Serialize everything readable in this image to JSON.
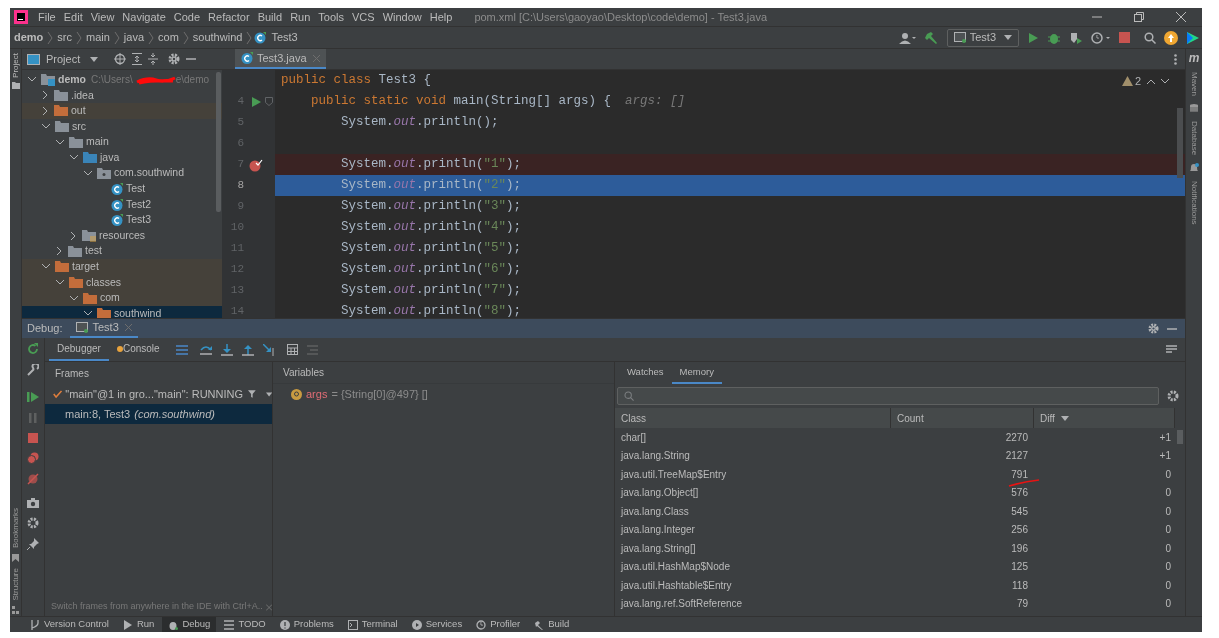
{
  "window": {
    "title": "pom.xml [C:\\Users\\gaoyao\\Desktop\\code\\demo] - Test3.java"
  },
  "menu": [
    "File",
    "Edit",
    "View",
    "Navigate",
    "Code",
    "Refactor",
    "Build",
    "Run",
    "Tools",
    "VCS",
    "Window",
    "Help"
  ],
  "breadcrumb": [
    "demo",
    "src",
    "main",
    "java",
    "com",
    "southwind",
    "Test3"
  ],
  "run_config": "Test3",
  "left_stripe": {
    "top": [
      "Project"
    ],
    "bottom": [
      "Bookmarks",
      "Structure"
    ]
  },
  "right_stripe": {
    "maven_icon": "m",
    "items": [
      "Maven",
      "Database",
      "Notifications"
    ]
  },
  "project_panel": {
    "title": "Project",
    "tree": [
      {
        "name": "demo",
        "path_start": "C:\\Users\\",
        "path_end": "e\\demo",
        "kind": "module",
        "expanded": true,
        "excluded": false,
        "selected": false,
        "children": [
          {
            "name": ".idea",
            "kind": "folder",
            "expanded": false,
            "excluded": false,
            "selected": false
          },
          {
            "name": "out",
            "kind": "folder",
            "expanded": false,
            "excluded": true,
            "selected": false
          },
          {
            "name": "src",
            "kind": "folder",
            "expanded": true,
            "excluded": false,
            "selected": false,
            "children": [
              {
                "name": "main",
                "kind": "folder",
                "expanded": true,
                "excluded": false,
                "selected": false,
                "children": [
                  {
                    "name": "java",
                    "kind": "source",
                    "expanded": true,
                    "excluded": false,
                    "selected": false,
                    "children": [
                      {
                        "name": "com.southwind",
                        "kind": "package",
                        "expanded": true,
                        "excluded": false,
                        "selected": false,
                        "children": [
                          {
                            "name": "Test",
                            "kind": "class",
                            "selected": false
                          },
                          {
                            "name": "Test2",
                            "kind": "class",
                            "selected": false
                          },
                          {
                            "name": "Test3",
                            "kind": "class",
                            "selected": false
                          }
                        ]
                      }
                    ]
                  },
                  {
                    "name": "resources",
                    "kind": "resources",
                    "expanded": false,
                    "excluded": false,
                    "selected": false
                  }
                ]
              },
              {
                "name": "test",
                "kind": "folder",
                "expanded": false,
                "excluded": false,
                "selected": false
              }
            ]
          },
          {
            "name": "target",
            "kind": "folder",
            "expanded": true,
            "excluded": true,
            "selected": false,
            "children": [
              {
                "name": "classes",
                "kind": "folder",
                "expanded": true,
                "excluded": true,
                "selected": false,
                "children": [
                  {
                    "name": "com",
                    "kind": "folder",
                    "expanded": true,
                    "excluded": true,
                    "selected": false,
                    "children": [
                      {
                        "name": "southwind",
                        "kind": "folder",
                        "expanded": true,
                        "excluded": true,
                        "selected": true
                      }
                    ]
                  }
                ]
              }
            ]
          }
        ]
      }
    ]
  },
  "editor": {
    "tab": "Test3.java",
    "warnings": "2",
    "lines": [
      {
        "tokens": [
          {
            "text": "public class ",
            "kind": "keyword"
          },
          {
            "text": "Test3 {",
            "kind": "plain"
          }
        ],
        "run": false,
        "breakpoint": false,
        "current": false
      },
      {
        "number": "4",
        "tokens": [
          {
            "text": "    public static void ",
            "kind": "keyword"
          },
          {
            "text": "main(String[] args) {",
            "kind": "plain"
          },
          {
            "text": "args: []",
            "kind": "hint"
          }
        ],
        "run": true,
        "breakpoint": false,
        "current": false
      },
      {
        "number": "5",
        "tokens": [
          {
            "text": "        System.",
            "kind": "plain"
          },
          {
            "text": "out",
            "kind": "field"
          },
          {
            "text": ".println();",
            "kind": "plain"
          }
        ],
        "run": false,
        "breakpoint": false,
        "current": false
      },
      {
        "number": "6",
        "run": false,
        "breakpoint": false,
        "current": false
      },
      {
        "number": "7",
        "tokens": [
          {
            "text": "        System.",
            "kind": "plain"
          },
          {
            "text": "out",
            "kind": "field"
          },
          {
            "text": ".println(",
            "kind": "plain"
          },
          {
            "text": "\"1\"",
            "kind": "string"
          },
          {
            "text": ");",
            "kind": "plain"
          }
        ],
        "run": false,
        "breakpoint": true,
        "current": false
      },
      {
        "number": "8",
        "tokens": [
          {
            "text": "        System.",
            "kind": "plain"
          },
          {
            "text": "out",
            "kind": "field"
          },
          {
            "text": ".println(",
            "kind": "plain"
          },
          {
            "text": "\"2\"",
            "kind": "string"
          },
          {
            "text": ");",
            "kind": "plain"
          }
        ],
        "run": false,
        "breakpoint": false,
        "current": true
      },
      {
        "number": "9",
        "tokens": [
          {
            "text": "        System.",
            "kind": "plain"
          },
          {
            "text": "out",
            "kind": "field"
          },
          {
            "text": ".println(",
            "kind": "plain"
          },
          {
            "text": "\"3\"",
            "kind": "string"
          },
          {
            "text": ");",
            "kind": "plain"
          }
        ],
        "run": false,
        "breakpoint": false,
        "current": false
      },
      {
        "number": "10",
        "tokens": [
          {
            "text": "        System.",
            "kind": "plain"
          },
          {
            "text": "out",
            "kind": "field"
          },
          {
            "text": ".println(",
            "kind": "plain"
          },
          {
            "text": "\"4\"",
            "kind": "string"
          },
          {
            "text": ");",
            "kind": "plain"
          }
        ],
        "run": false,
        "breakpoint": false,
        "current": false
      },
      {
        "number": "11",
        "tokens": [
          {
            "text": "        System.",
            "kind": "plain"
          },
          {
            "text": "out",
            "kind": "field"
          },
          {
            "text": ".println(",
            "kind": "plain"
          },
          {
            "text": "\"5\"",
            "kind": "string"
          },
          {
            "text": ");",
            "kind": "plain"
          }
        ],
        "run": false,
        "breakpoint": false,
        "current": false
      },
      {
        "number": "12",
        "tokens": [
          {
            "text": "        System.",
            "kind": "plain"
          },
          {
            "text": "out",
            "kind": "field"
          },
          {
            "text": ".println(",
            "kind": "plain"
          },
          {
            "text": "\"6\"",
            "kind": "string"
          },
          {
            "text": ");",
            "kind": "plain"
          }
        ],
        "run": false,
        "breakpoint": false,
        "current": false
      },
      {
        "number": "13",
        "tokens": [
          {
            "text": "        System.",
            "kind": "plain"
          },
          {
            "text": "out",
            "kind": "field"
          },
          {
            "text": ".println(",
            "kind": "plain"
          },
          {
            "text": "\"7\"",
            "kind": "string"
          },
          {
            "text": ");",
            "kind": "plain"
          }
        ],
        "run": false,
        "breakpoint": false,
        "current": false
      },
      {
        "number": "14",
        "tokens": [
          {
            "text": "        System.",
            "kind": "plain"
          },
          {
            "text": "out",
            "kind": "field"
          },
          {
            "text": ".println(",
            "kind": "plain"
          },
          {
            "text": "\"8\"",
            "kind": "string"
          },
          {
            "text": ");",
            "kind": "plain"
          }
        ],
        "run": false,
        "breakpoint": false,
        "current": false
      }
    ]
  },
  "debug": {
    "label": "Debug:",
    "session_tab": "Test3",
    "tabs": [
      {
        "label": "Debugger",
        "selected": true
      },
      {
        "label": "Console",
        "selected": false
      }
    ],
    "frames": {
      "header": "Frames",
      "thread": "\"main\"@1 in gro...\"main\": RUNNING",
      "items": [
        {
          "text": "main:8, Test3",
          "package": "(com.southwind)",
          "selected": true
        }
      ],
      "hint": "Switch frames from anywhere in the IDE with Ctrl+A.."
    },
    "variables": {
      "header": "Variables",
      "items": [
        {
          "name": "args",
          "value": "= {String[0]@497} []"
        }
      ]
    },
    "memory": {
      "tabs": [
        {
          "label": "Watches",
          "selected": false
        },
        {
          "label": "Memory",
          "selected": true
        }
      ],
      "columns": [
        "Class",
        "Count",
        "Diff"
      ],
      "rows": [
        {
          "class": "char[]",
          "count": "2270",
          "diff": "+1"
        },
        {
          "class": "java.lang.String",
          "count": "2127",
          "diff": "+1"
        },
        {
          "class": "java.util.TreeMap$Entry",
          "count": "791",
          "diff": "0"
        },
        {
          "class": "java.lang.Object[]",
          "count": "576",
          "diff": "0"
        },
        {
          "class": "java.lang.Class",
          "count": "545",
          "diff": "0"
        },
        {
          "class": "java.lang.Integer",
          "count": "256",
          "diff": "0"
        },
        {
          "class": "java.lang.String[]",
          "count": "196",
          "diff": "0"
        },
        {
          "class": "java.util.HashMap$Node",
          "count": "125",
          "diff": "0"
        },
        {
          "class": "java.util.Hashtable$Entry",
          "count": "118",
          "diff": "0"
        },
        {
          "class": "java.lang.ref.SoftReference",
          "count": "79",
          "diff": "0"
        }
      ]
    }
  },
  "status_bar": [
    {
      "label": "Version Control",
      "selected": false
    },
    {
      "label": "Run",
      "selected": false
    },
    {
      "label": "Debug",
      "selected": true
    },
    {
      "label": "TODO",
      "selected": false
    },
    {
      "label": "Problems",
      "selected": false
    },
    {
      "label": "Terminal",
      "selected": false
    },
    {
      "label": "Services",
      "selected": false
    },
    {
      "label": "Profiler",
      "selected": false
    },
    {
      "label": "Build",
      "selected": false
    }
  ]
}
